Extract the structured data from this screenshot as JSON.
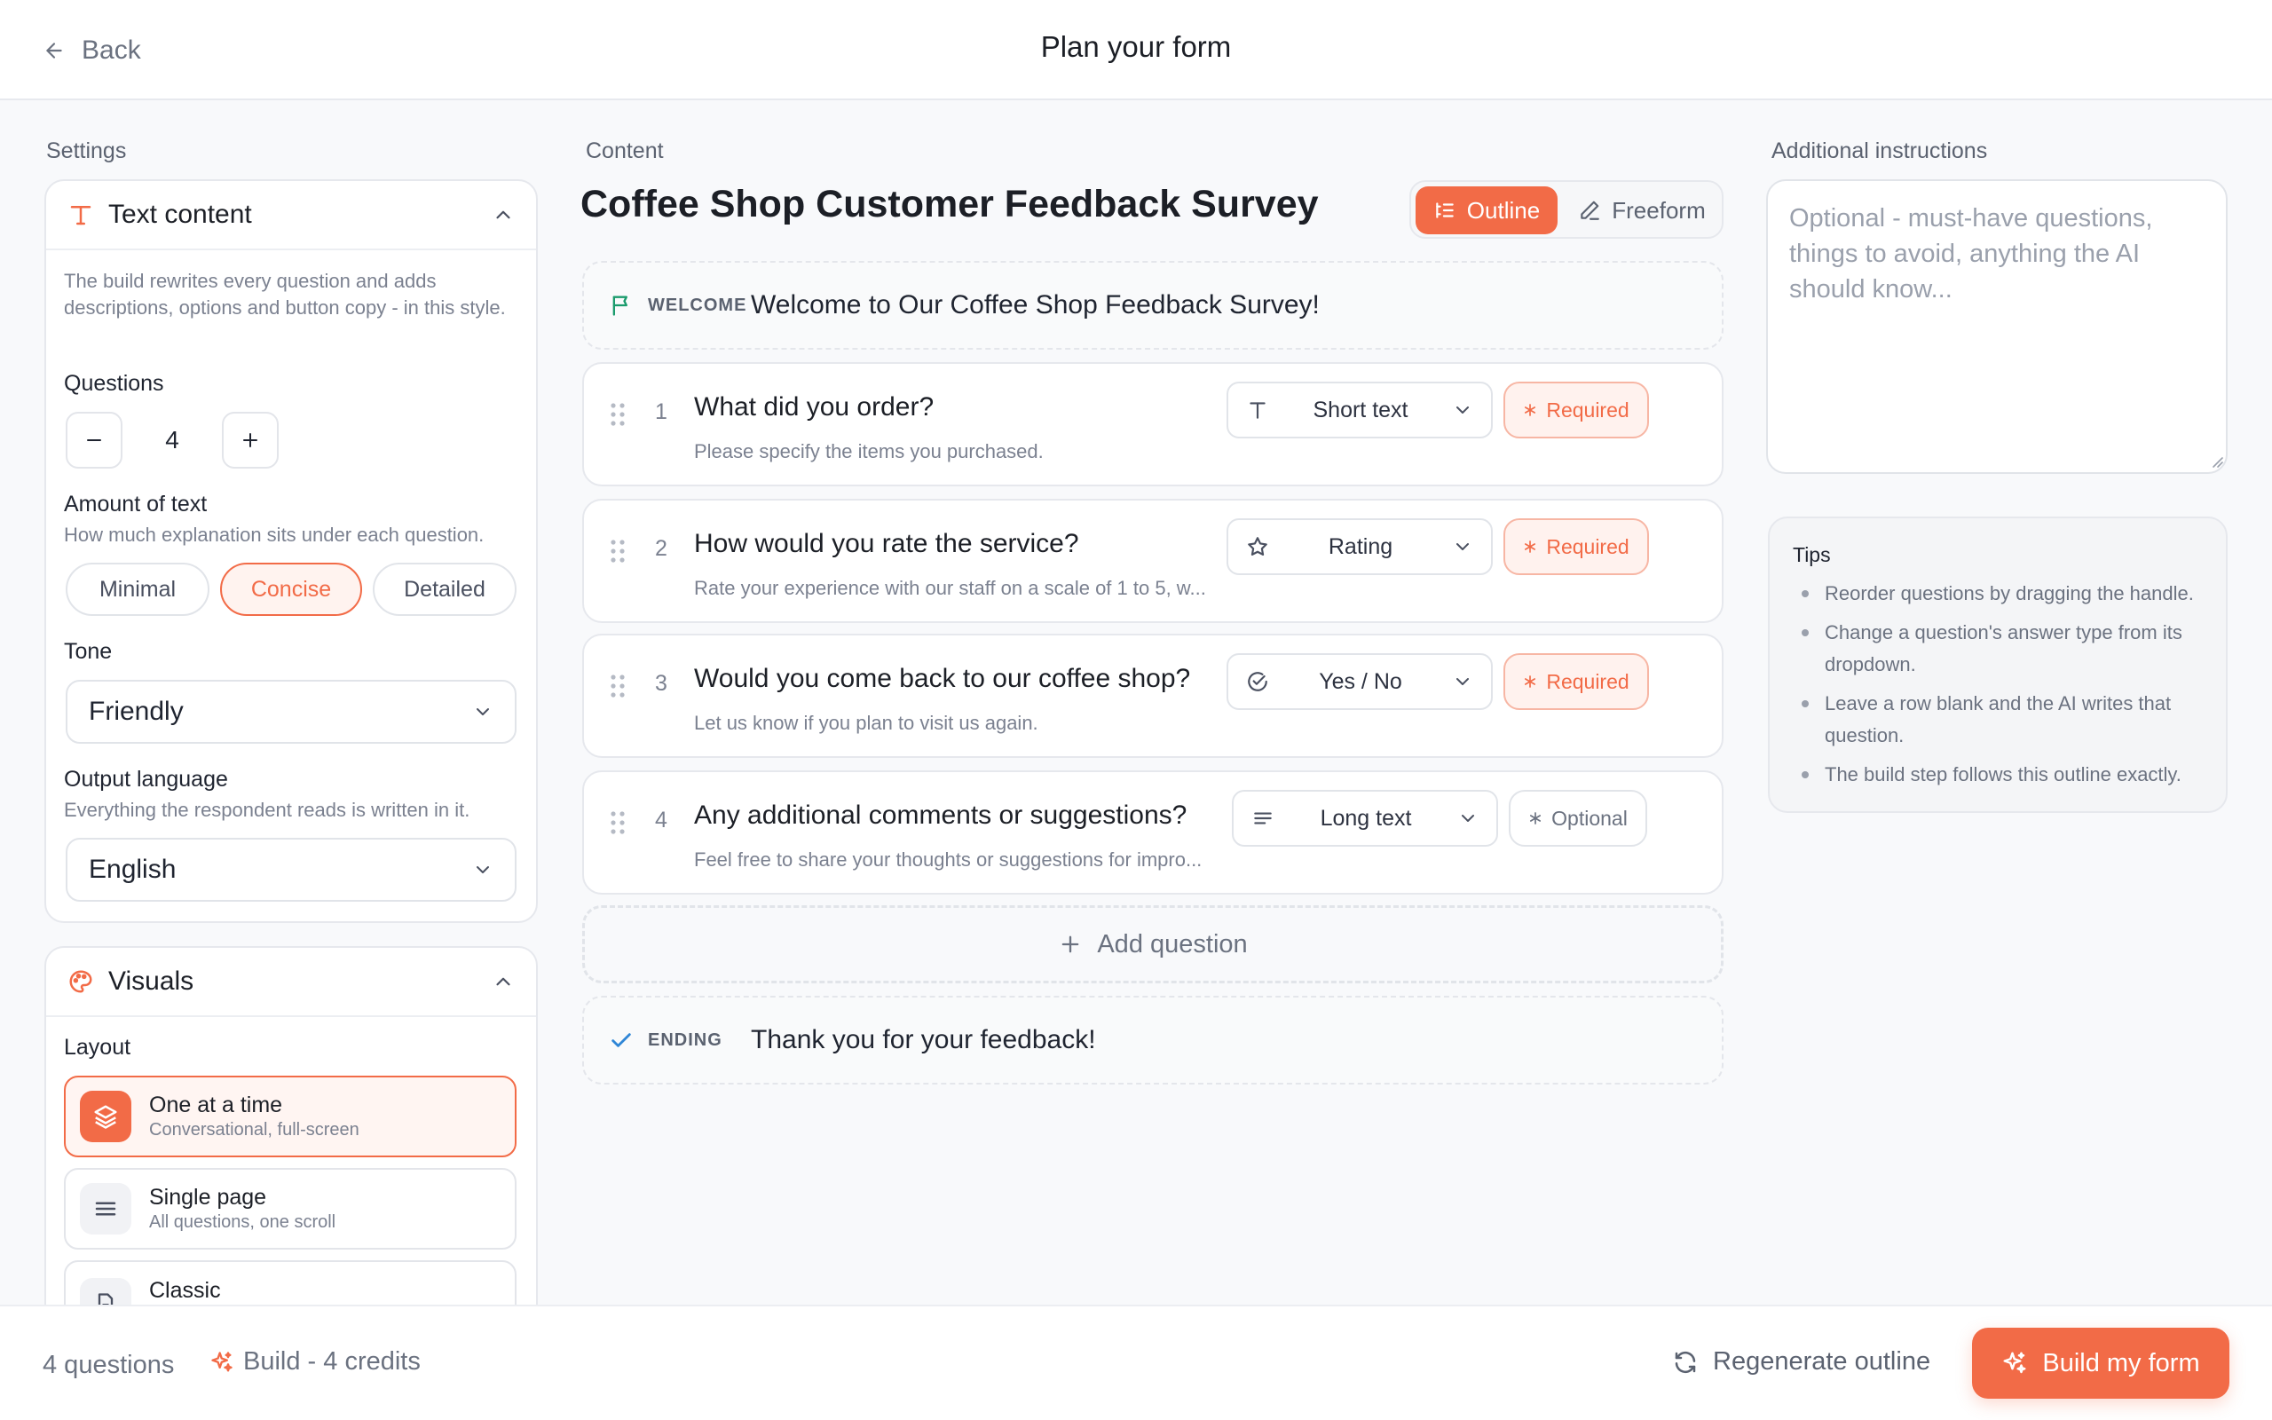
{
  "header": {
    "back_label": "Back",
    "title": "Plan your form"
  },
  "settings": {
    "label": "Settings",
    "text_content": {
      "title": "Text content",
      "description": "The build rewrites every question and adds descriptions, options and button copy - in this style.",
      "questions_label": "Questions",
      "questions_value": "4",
      "amount_label": "Amount of text",
      "amount_help": "How much explanation sits under each question.",
      "amount_options": [
        "Minimal",
        "Concise",
        "Detailed"
      ],
      "amount_selected": "Concise",
      "tone_label": "Tone",
      "tone_value": "Friendly",
      "language_label": "Output language",
      "language_help": "Everything the respondent reads is written in it.",
      "language_value": "English"
    },
    "visuals": {
      "title": "Visuals",
      "layout_label": "Layout",
      "layouts": [
        {
          "title": "One at a time",
          "subtitle": "Conversational, full-screen"
        },
        {
          "title": "Single page",
          "subtitle": "All questions, one scroll"
        },
        {
          "title": "Classic",
          "subtitle": ""
        }
      ],
      "layout_selected": "One at a time"
    }
  },
  "content": {
    "label": "Content",
    "title": "Coffee Shop Customer Feedback Survey",
    "mode": {
      "outline": "Outline",
      "freeform": "Freeform",
      "selected": "Outline"
    },
    "welcome": {
      "tag": "WELCOME",
      "text": "Welcome to Our Coffee Shop Feedback Survey!"
    },
    "questions": [
      {
        "num": "1",
        "title": "What did you order?",
        "desc": "Please specify the items you purchased.",
        "type": "Short text",
        "type_icon": "text-type-icon",
        "required": "Required"
      },
      {
        "num": "2",
        "title": "How would you rate the service?",
        "desc": "Rate your experience with our staff on a scale of 1 to 5, w...",
        "type": "Rating",
        "type_icon": "star-icon",
        "required": "Required"
      },
      {
        "num": "3",
        "title": "Would you come back to our coffee shop?",
        "desc": "Let us know if you plan to visit us again.",
        "type": "Yes / No",
        "type_icon": "check-circle-icon",
        "required": "Required"
      },
      {
        "num": "4",
        "title": "Any additional comments or suggestions?",
        "desc": "Feel free to share your thoughts or suggestions for impro...",
        "type": "Long text",
        "type_icon": "long-text-icon",
        "required": "Optional"
      }
    ],
    "add_question": "Add question",
    "ending": {
      "tag": "ENDING",
      "text": "Thank you for your feedback!"
    }
  },
  "instructions": {
    "label": "Additional instructions",
    "placeholder": "Optional - must-have questions, things to avoid, anything the AI should know...",
    "value": ""
  },
  "tips": {
    "title": "Tips",
    "items": [
      "Reorder questions by dragging the handle.",
      "Change a question's answer type from its dropdown.",
      "Leave a row blank and the AI writes that question.",
      "The build step follows this outline exactly."
    ]
  },
  "footer": {
    "count": "4 questions",
    "build_cost": "Build - 4 credits",
    "regenerate": "Regenerate outline",
    "build_button": "Build my form"
  },
  "colors": {
    "accent": "#f26b47",
    "accent_bg": "#fff3ef",
    "border": "#e6e8ed",
    "muted_text": "#7b8190"
  }
}
